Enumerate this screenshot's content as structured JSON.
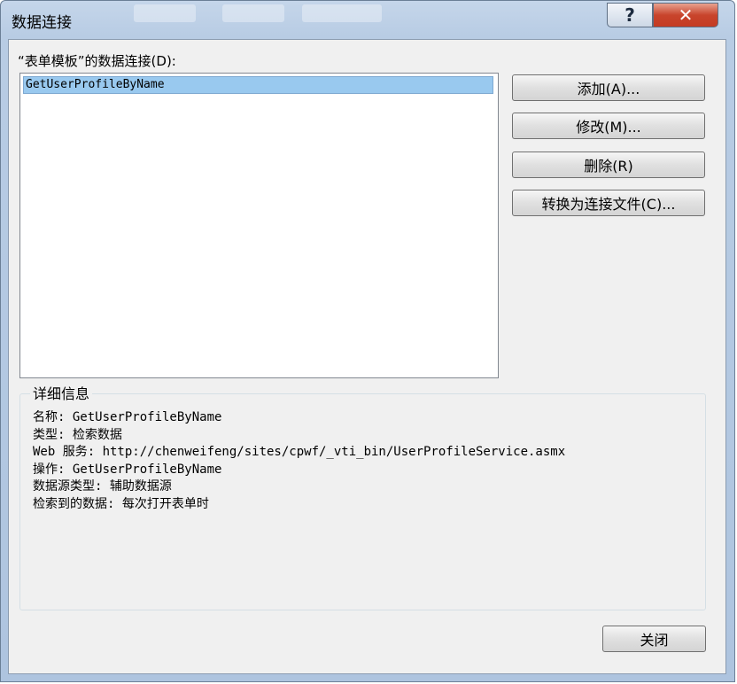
{
  "window": {
    "title": "数据连接"
  },
  "title_buttons": {
    "help": "?",
    "close": "✕"
  },
  "connections": {
    "label": "“表单模板”的数据连接(D):",
    "items": [
      "GetUserProfileByName"
    ]
  },
  "buttons": {
    "add": "添加(A)...",
    "modify": "修改(M)...",
    "delete": "删除(R)",
    "convert": "转换为连接文件(C)...",
    "close": "关闭"
  },
  "details": {
    "title": "详细信息",
    "lines": [
      "名称: GetUserProfileByName",
      "类型: 检索数据",
      "Web 服务: http://chenweifeng/sites/cpwf/_vti_bin/UserProfileService.asmx",
      "操作: GetUserProfileByName",
      "数据源类型: 辅助数据源",
      "检索到的数据: 每次打开表单时"
    ]
  }
}
